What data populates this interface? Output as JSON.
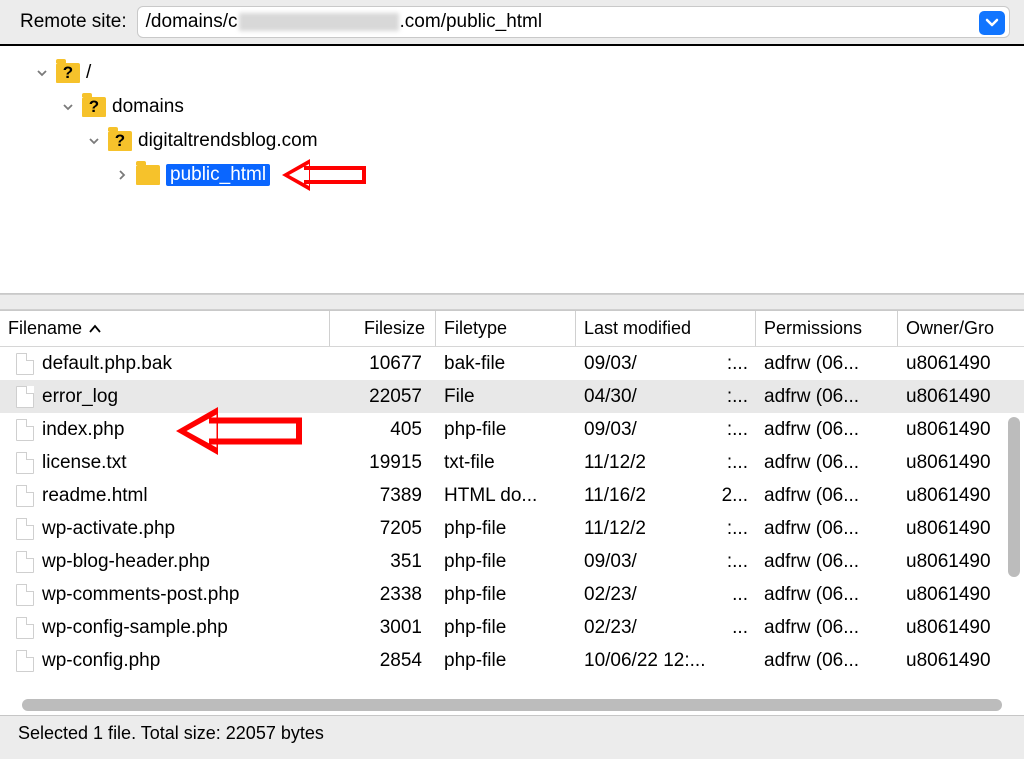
{
  "remote": {
    "label": "Remote site:",
    "path_prefix": "/domains/c",
    "path_suffix": ".com/public_html"
  },
  "tree": {
    "root": "/",
    "domains": "domains",
    "site": "digitaltrendsblog.com",
    "public_html": "public_html"
  },
  "columns": {
    "filename": "Filename",
    "filesize": "Filesize",
    "filetype": "Filetype",
    "lastmodified": "Last modified",
    "permissions": "Permissions",
    "owner": "Owner/Gro"
  },
  "files": [
    {
      "name": "default.php.bak",
      "size": "10677",
      "type": "bak-file",
      "mod": "09/03/",
      "mod2": ":...",
      "perm": "adfrw (06...",
      "own": "u8061490"
    },
    {
      "name": "error_log",
      "size": "22057",
      "type": "File",
      "mod": "04/30/",
      "mod2": ":...",
      "perm": "adfrw (06...",
      "own": "u8061490",
      "selected": true
    },
    {
      "name": "index.php",
      "size": "405",
      "type": "php-file",
      "mod": "09/03/",
      "mod2": ":...",
      "perm": "adfrw (06...",
      "own": "u8061490"
    },
    {
      "name": "license.txt",
      "size": "19915",
      "type": "txt-file",
      "mod": "11/12/2",
      "mod2": ":...",
      "perm": "adfrw (06...",
      "own": "u8061490"
    },
    {
      "name": "readme.html",
      "size": "7389",
      "type": "HTML do...",
      "mod": "11/16/2",
      "mod2": "2...",
      "perm": "adfrw (06...",
      "own": "u8061490"
    },
    {
      "name": "wp-activate.php",
      "size": "7205",
      "type": "php-file",
      "mod": "11/12/2",
      "mod2": ":...",
      "perm": "adfrw (06...",
      "own": "u8061490"
    },
    {
      "name": "wp-blog-header.php",
      "size": "351",
      "type": "php-file",
      "mod": "09/03/",
      "mod2": ":...",
      "perm": "adfrw (06...",
      "own": "u8061490"
    },
    {
      "name": "wp-comments-post.php",
      "size": "2338",
      "type": "php-file",
      "mod": "02/23/",
      "mod2": "...",
      "perm": "adfrw (06...",
      "own": "u8061490"
    },
    {
      "name": "wp-config-sample.php",
      "size": "3001",
      "type": "php-file",
      "mod": "02/23/",
      "mod2": "...",
      "perm": "adfrw (06...",
      "own": "u8061490"
    },
    {
      "name": "wp-config.php",
      "size": "2854",
      "type": "php-file",
      "mod": "10/06/22 12:...",
      "mod2": "",
      "perm": "adfrw (06...",
      "own": "u8061490"
    }
  ],
  "status": "Selected 1 file. Total size: 22057 bytes"
}
